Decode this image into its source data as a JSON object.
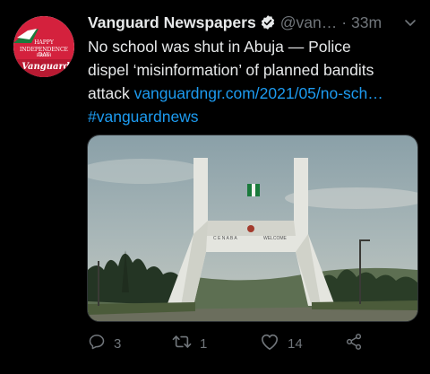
{
  "tweet": {
    "display_name": "Vanguard Newspapers",
    "handle": "@van…",
    "separator": "·",
    "time": "33m",
    "text_lines": [
      "No school was shut in Abuja — Police",
      "dispel ‘misinformation’ of planned bandits"
    ],
    "text_line3_prefix": "attack ",
    "link": "vanguardngr.com/2021/05/no-sch…",
    "hashtag": "#vanguardnews"
  },
  "avatar": {
    "line1": "HAPPY",
    "line2": "INDEPENDENCE DAY",
    "line3": "FROM",
    "logo": "Vanguard"
  },
  "media": {
    "gate_text_left": "C E N  A B A",
    "gate_text_right": "WELCOME"
  },
  "actions": {
    "reply_count": "3",
    "retweet_count": "1",
    "like_count": "14"
  },
  "icons": {
    "verified": "verified-badge-icon",
    "caret": "chevron-down-icon",
    "reply": "reply-icon",
    "retweet": "retweet-icon",
    "like": "heart-icon",
    "share": "share-icon"
  },
  "colors": {
    "background": "#000000",
    "primary_text": "#e7e9ea",
    "secondary_text": "#71767b",
    "link": "#1d9bf0",
    "avatar_red": "#d4213d"
  }
}
